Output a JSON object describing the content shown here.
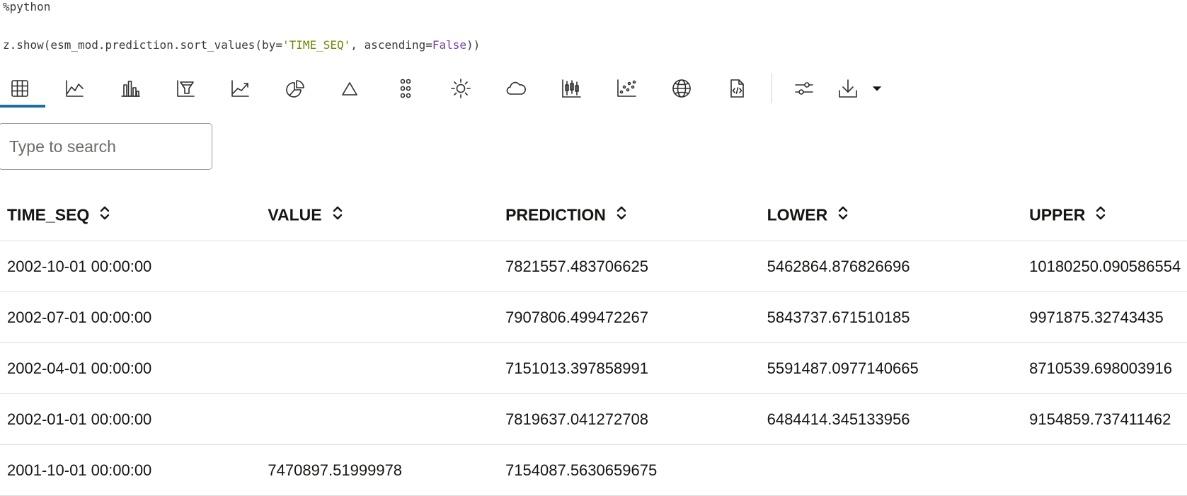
{
  "code": {
    "line1": "%python",
    "line2_prefix": "z.show(esm_mod.prediction.sort_values(by=",
    "line2_str": "'TIME_SEQ'",
    "line2_mid": ", ascending=",
    "line2_kw": "False",
    "line2_suffix": "))"
  },
  "toolbar": {
    "buttons": [
      {
        "icon": "table-icon"
      },
      {
        "icon": "line-chart-icon"
      },
      {
        "icon": "bar-chart-icon"
      },
      {
        "icon": "funnel-chart-icon"
      },
      {
        "icon": "area-chart-icon"
      },
      {
        "icon": "pie-chart-icon"
      },
      {
        "icon": "pyramid-chart-icon"
      },
      {
        "icon": "dot-matrix-icon"
      },
      {
        "icon": "sunburst-icon"
      },
      {
        "icon": "tag-cloud-icon"
      },
      {
        "icon": "box-plot-icon"
      },
      {
        "icon": "scatter-chart-icon"
      },
      {
        "icon": "map-globe-icon"
      },
      {
        "icon": "code-file-icon"
      },
      {
        "icon": "settings-sliders-icon"
      },
      {
        "icon": "download-icon"
      },
      {
        "icon": "chevron-down-icon"
      }
    ],
    "active_index": 0
  },
  "search": {
    "placeholder": "Type to search",
    "value": ""
  },
  "table": {
    "columns": [
      "TIME_SEQ",
      "VALUE",
      "PREDICTION",
      "LOWER",
      "UPPER"
    ],
    "rows": [
      [
        "2002-10-01 00:00:00",
        "",
        "7821557.483706625",
        "5462864.876826696",
        "10180250.090586554"
      ],
      [
        "2002-07-01 00:00:00",
        "",
        "7907806.499472267",
        "5843737.671510185",
        "9971875.32743435"
      ],
      [
        "2002-04-01 00:00:00",
        "",
        "7151013.397858991",
        "5591487.0977140665",
        "8710539.698003916"
      ],
      [
        "2002-01-01 00:00:00",
        "",
        "7819637.041272708",
        "6484414.345133956",
        "9154859.737411462"
      ],
      [
        "2001-10-01 00:00:00",
        "7470897.51999978",
        "7154087.5630659675",
        "",
        ""
      ]
    ]
  }
}
